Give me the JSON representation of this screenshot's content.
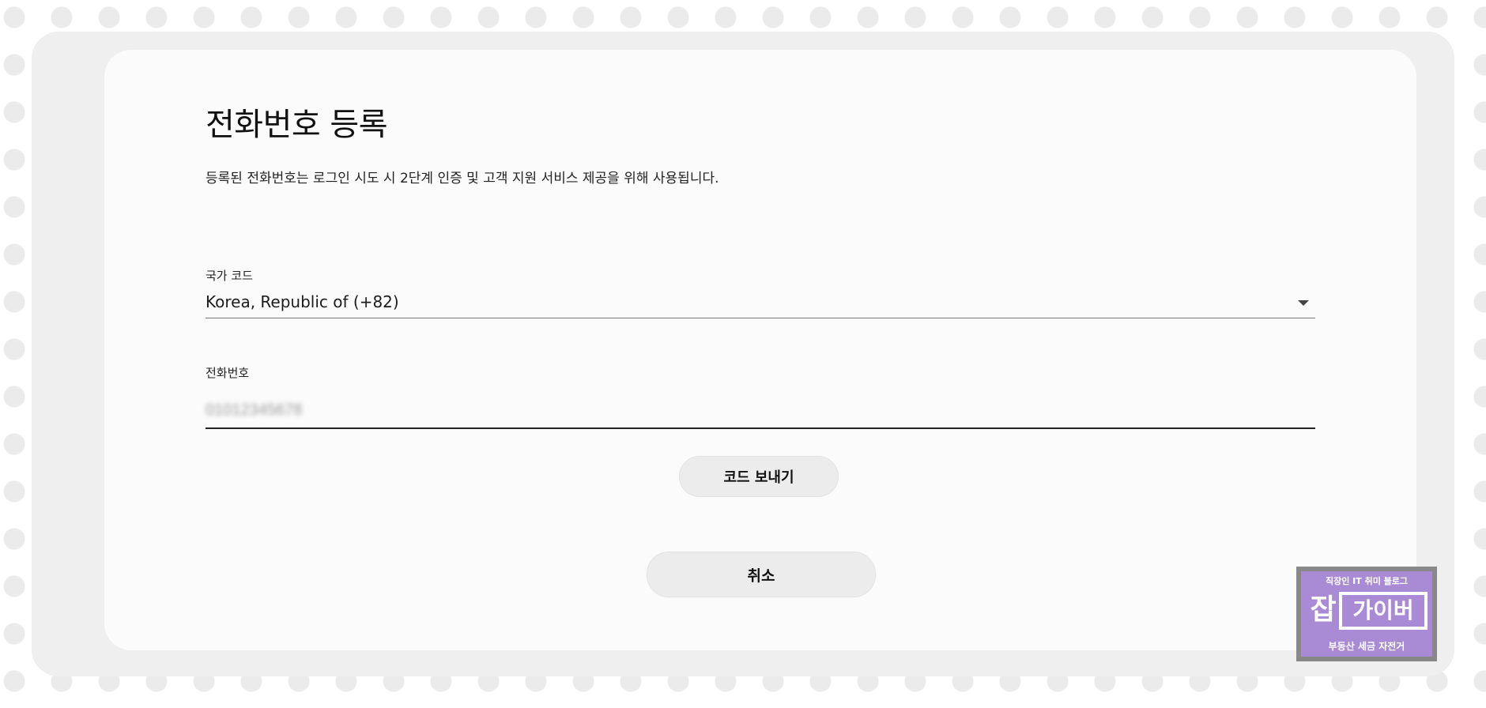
{
  "dialog": {
    "title": "전화번호 등록",
    "description": "등록된 전화번호는 로그인 시도 시 2단계 인증 및 고객 지원 서비스 제공을 위해 사용됩니다."
  },
  "country_field": {
    "label": "국가 코드",
    "selected_value": "Korea, Republic of (+82)",
    "icon": "chevron-down-icon"
  },
  "phone_field": {
    "label": "전화번호",
    "value": "01012345678",
    "value_blurred": true
  },
  "buttons": {
    "send_code_label": "코드 보내기",
    "cancel_label": "취소"
  },
  "watermark": {
    "top_text": "직장인 IT 취미 블로그",
    "main_char": "잡",
    "main_text": "가이버",
    "bottom_text": "부동산 세금 자전거",
    "colors": {
      "background": "#a98ad4",
      "border": "#888888",
      "text": "#ffffff"
    }
  }
}
